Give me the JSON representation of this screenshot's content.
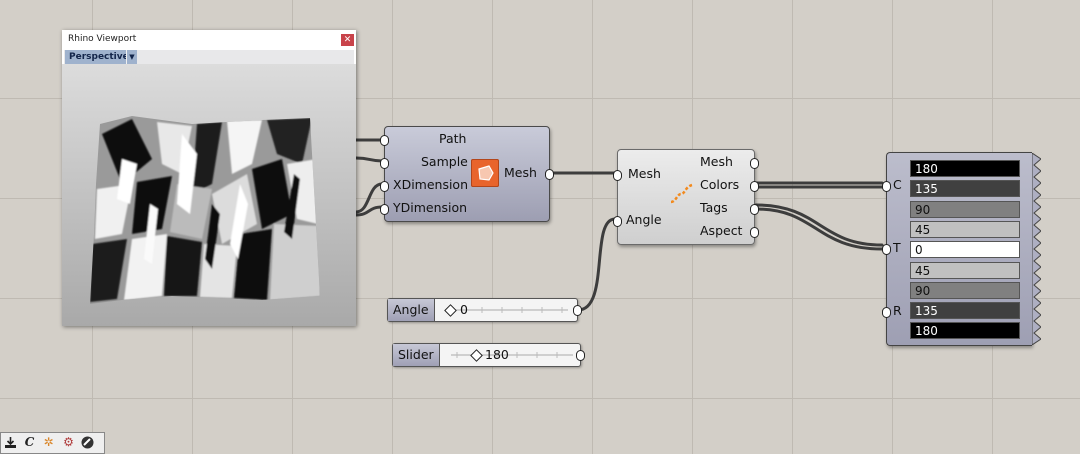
{
  "viewport": {
    "title": "Rhino Viewport",
    "close_icon": "close-icon",
    "view_tab": "Perspective"
  },
  "mesh_component": {
    "inputs": [
      "Path",
      "Sample",
      "XDimension",
      "YDimension"
    ],
    "output": "Mesh",
    "icon": "terrain-mesh-icon",
    "icon_color": "#e8642c"
  },
  "analysis_component": {
    "inputs": [
      "Mesh",
      "Angle"
    ],
    "outputs": [
      "Mesh",
      "Colors",
      "Tags",
      "Aspect"
    ],
    "icon": "sine-wave-icon"
  },
  "angle_slider": {
    "label": "Angle",
    "value": "0",
    "fraction": 0.0
  },
  "value_slider": {
    "label": "Slider",
    "value": "180",
    "fraction": 0.2
  },
  "color_panel": {
    "ports": [
      "C",
      "T",
      "R"
    ],
    "values": [
      {
        "text": "180",
        "bg": "#000000",
        "fg": "#ffffff"
      },
      {
        "text": "135",
        "bg": "#404040",
        "fg": "#ffffff"
      },
      {
        "text": "90",
        "bg": "#808080",
        "fg": "#111111"
      },
      {
        "text": "45",
        "bg": "#c0c0c0",
        "fg": "#111111"
      },
      {
        "text": "0",
        "bg": "#ffffff",
        "fg": "#111111"
      },
      {
        "text": "45",
        "bg": "#c0c0c0",
        "fg": "#111111"
      },
      {
        "text": "90",
        "bg": "#808080",
        "fg": "#111111"
      },
      {
        "text": "135",
        "bg": "#404040",
        "fg": "#ffffff"
      },
      {
        "text": "180",
        "bg": "#000000",
        "fg": "#ffffff"
      }
    ]
  },
  "toolbar": {
    "icons": [
      "download-icon",
      "script-c-icon",
      "sparkle-icon",
      "gear-grid-icon",
      "disc-icon"
    ],
    "script_glyph": "C"
  }
}
